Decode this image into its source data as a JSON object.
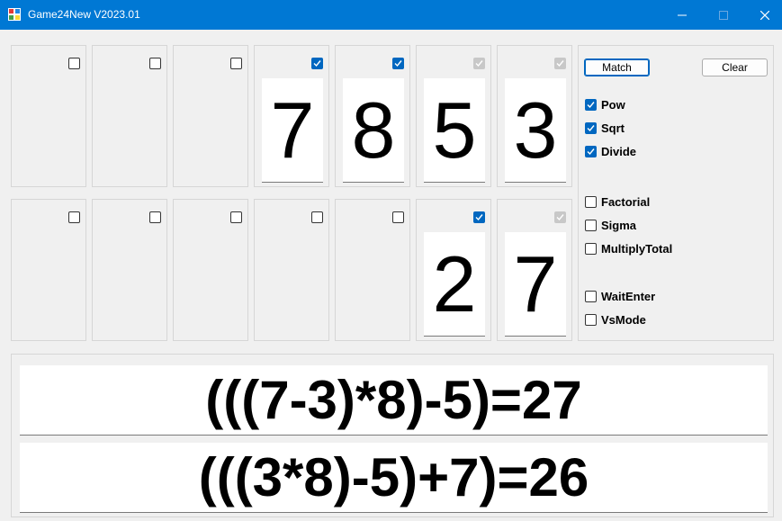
{
  "window": {
    "title": "Game24New V2023.01",
    "accent": "#0078d4"
  },
  "cards_top": [
    {
      "checked": false,
      "disabled": false,
      "value": ""
    },
    {
      "checked": false,
      "disabled": false,
      "value": ""
    },
    {
      "checked": false,
      "disabled": false,
      "value": ""
    },
    {
      "checked": true,
      "disabled": false,
      "value": "7"
    },
    {
      "checked": true,
      "disabled": false,
      "value": "8"
    },
    {
      "checked": true,
      "disabled": true,
      "value": "5"
    },
    {
      "checked": true,
      "disabled": true,
      "value": "3"
    }
  ],
  "cards_bottom": [
    {
      "checked": false,
      "disabled": false,
      "value": ""
    },
    {
      "checked": false,
      "disabled": false,
      "value": ""
    },
    {
      "checked": false,
      "disabled": false,
      "value": ""
    },
    {
      "checked": false,
      "disabled": false,
      "value": ""
    },
    {
      "checked": false,
      "disabled": false,
      "value": ""
    },
    {
      "checked": true,
      "disabled": false,
      "value": "2"
    },
    {
      "checked": true,
      "disabled": true,
      "value": "7"
    }
  ],
  "controls": {
    "match_label": "Match",
    "clear_label": "Clear",
    "options": [
      {
        "label": "Pow",
        "checked": true
      },
      {
        "label": "Sqrt",
        "checked": true
      },
      {
        "label": "Divide",
        "checked": true
      },
      {
        "label": "Factorial",
        "checked": false
      },
      {
        "label": "Sigma",
        "checked": false
      },
      {
        "label": "MultiplyTotal",
        "checked": false
      },
      {
        "label": "WaitEnter",
        "checked": false
      },
      {
        "label": "VsMode",
        "checked": false
      }
    ]
  },
  "results": {
    "line1": "(((7-3)*8)-5)=27",
    "line2": "(((3*8)-5)+7)=26"
  }
}
